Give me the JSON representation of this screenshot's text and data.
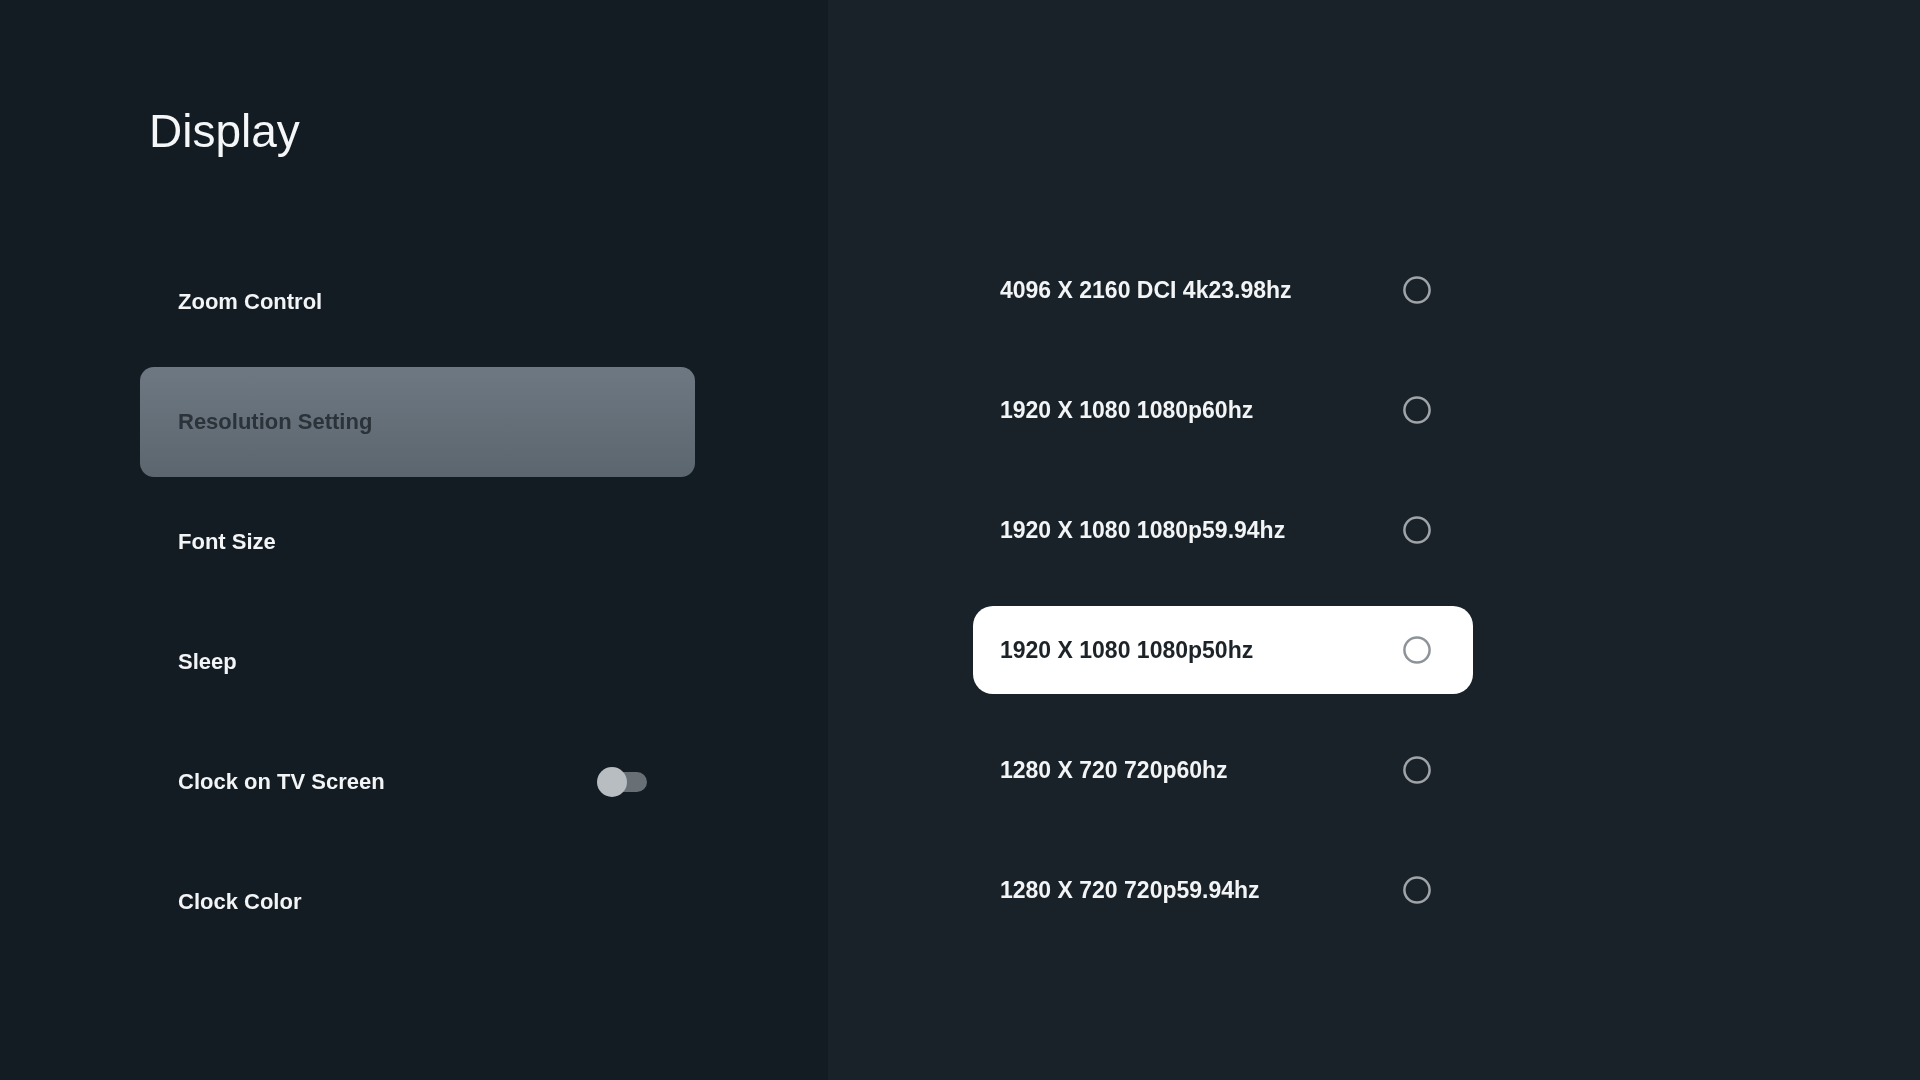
{
  "screen": {
    "title": "Display"
  },
  "menu": {
    "items": [
      {
        "label": "Zoom Control",
        "kind": "plain",
        "selected": false
      },
      {
        "label": "Resolution Setting",
        "kind": "plain",
        "selected": true
      },
      {
        "label": "Font Size",
        "kind": "plain",
        "selected": false
      },
      {
        "label": "Sleep",
        "kind": "plain",
        "selected": false
      },
      {
        "label": "Clock on TV Screen",
        "kind": "toggle",
        "selected": false,
        "on": false
      },
      {
        "label": "Clock Color",
        "kind": "plain",
        "selected": false
      }
    ]
  },
  "options": {
    "items": [
      {
        "label": "4096 X 2160 DCI 4k23.98hz",
        "focused": false,
        "checked": false
      },
      {
        "label": "1920 X 1080 1080p60hz",
        "focused": false,
        "checked": false
      },
      {
        "label": "1920 X 1080 1080p59.94hz",
        "focused": false,
        "checked": false
      },
      {
        "label": "1920 X 1080 1080p50hz",
        "focused": true,
        "checked": false
      },
      {
        "label": "1280 X 720 720p60hz",
        "focused": false,
        "checked": false
      },
      {
        "label": "1280 X 720 720p59.94hz",
        "focused": false,
        "checked": false
      }
    ]
  }
}
